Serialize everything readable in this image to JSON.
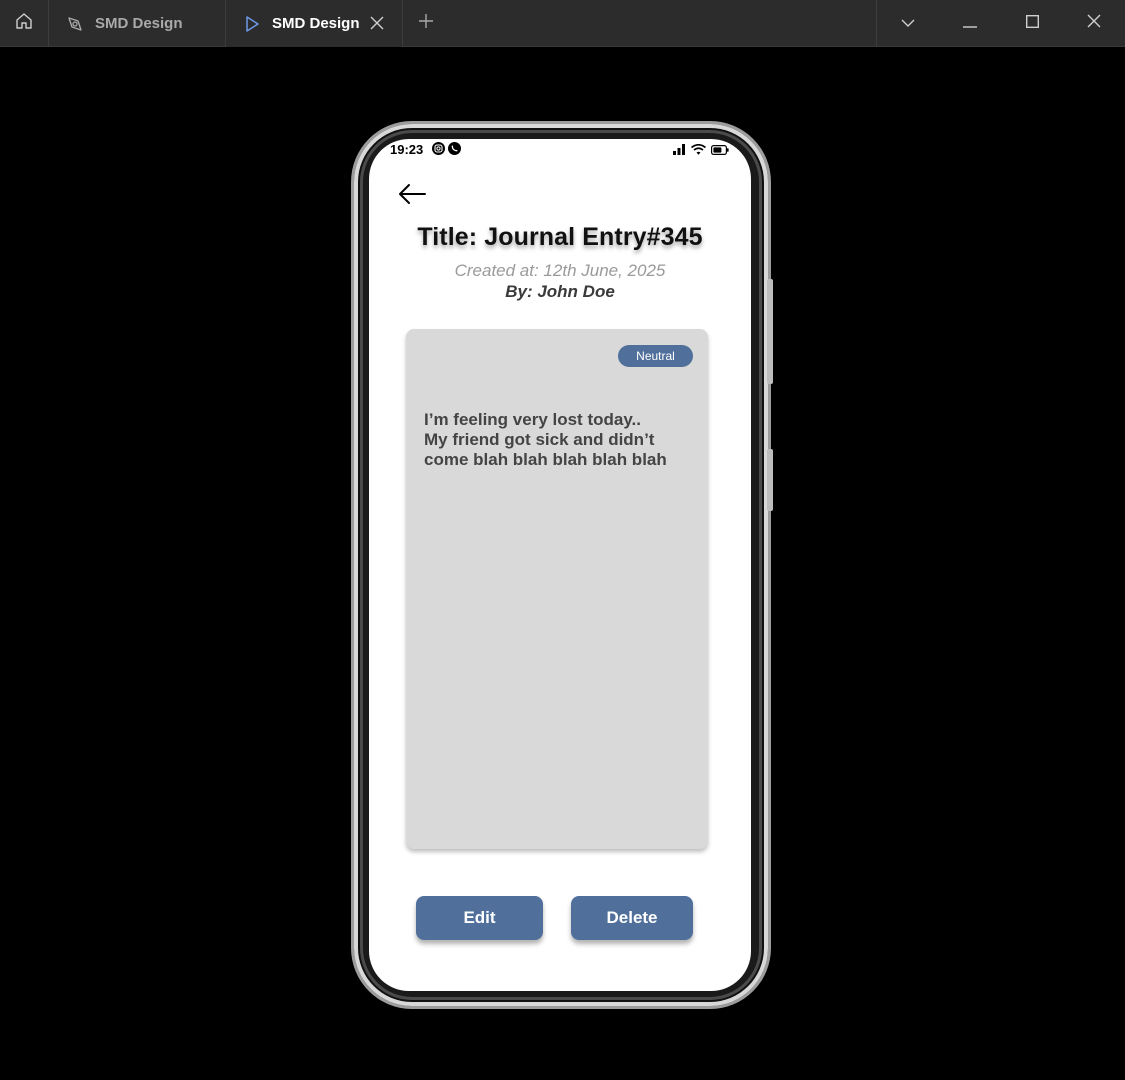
{
  "window": {
    "tabs": [
      {
        "label": "SMD Design",
        "icon": "figma-design-icon",
        "active": false
      },
      {
        "label": "SMD Design",
        "icon": "play-prototype-icon",
        "active": true
      }
    ],
    "controls": [
      "chevron-down-icon",
      "minimize-icon",
      "maximize-icon",
      "close-icon"
    ],
    "background_color": "#000000",
    "titlebar_color": "#2c2c2c"
  },
  "status_bar": {
    "time": "19:23",
    "app_icons": [
      "instagram-icon",
      "whatsapp-icon"
    ],
    "indicators": [
      "signal-icon",
      "wifi-icon",
      "battery-icon"
    ]
  },
  "entry": {
    "title": "Title: Journal Entry#345",
    "created_at": "Created at: 12th June, 2025",
    "author": "By: John Doe",
    "mood": "Neutral",
    "text_lines": [
      "I’m feeling very lost today..",
      "My friend got sick and didn’t",
      "come blah blah blah blah blah"
    ]
  },
  "actions": {
    "edit_label": "Edit",
    "delete_label": "Delete"
  },
  "colors": {
    "accent": "#50709b",
    "card": "#d9d9d9",
    "screen": "#ffffff"
  }
}
